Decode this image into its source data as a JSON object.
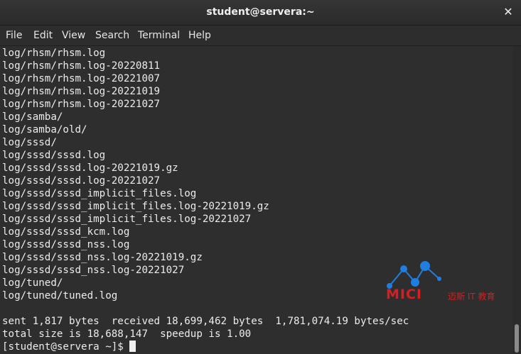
{
  "window": {
    "title": "student@servera:~",
    "close_glyph": "✕"
  },
  "menu": {
    "items": [
      "File",
      "Edit",
      "View",
      "Search",
      "Terminal",
      "Help"
    ]
  },
  "terminal": {
    "lines": [
      "log/rhsm/rhsm.log",
      "log/rhsm/rhsm.log-20220811",
      "log/rhsm/rhsm.log-20221007",
      "log/rhsm/rhsm.log-20221019",
      "log/rhsm/rhsm.log-20221027",
      "log/samba/",
      "log/samba/old/",
      "log/sssd/",
      "log/sssd/sssd.log",
      "log/sssd/sssd.log-20221019.gz",
      "log/sssd/sssd.log-20221027",
      "log/sssd/sssd_implicit_files.log",
      "log/sssd/sssd_implicit_files.log-20221019.gz",
      "log/sssd/sssd_implicit_files.log-20221027",
      "log/sssd/sssd_kcm.log",
      "log/sssd/sssd_nss.log",
      "log/sssd/sssd_nss.log-20221019.gz",
      "log/sssd/sssd_nss.log-20221027",
      "log/tuned/",
      "log/tuned/tuned.log",
      "",
      "sent 1,817 bytes  received 18,699,462 bytes  1,781,074.19 bytes/sec",
      "total size is 18,688,147  speedup is 1.00"
    ],
    "prompt": "[student@servera ~]$ "
  },
  "watermark": {
    "brand": "MICI",
    "subtitle": "迈斯 IT 教育",
    "color": "#d81e1e",
    "icon_color": "#1e7fe0"
  }
}
